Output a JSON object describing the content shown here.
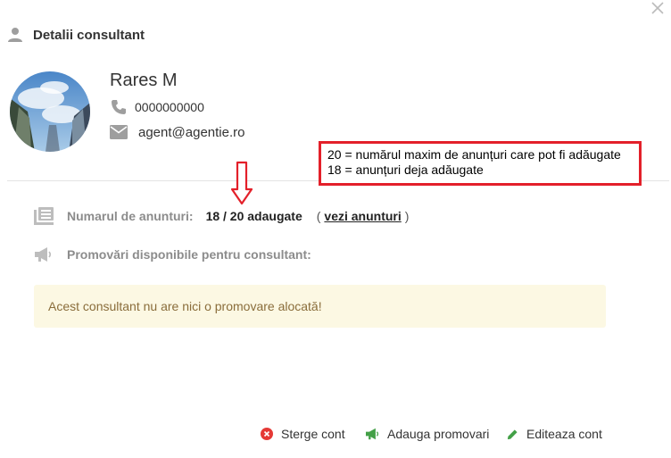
{
  "modal": {
    "title": "Detalii consultant",
    "close_icon": "close-icon"
  },
  "consultant": {
    "name": "Rares M",
    "phone": "0000000000",
    "email": "agent@agentie.ro"
  },
  "annotation": {
    "line1": "20 = numărul maxim de anunțuri care pot fi adăugate",
    "line2": "18 = anunțuri deja adăugate",
    "color": "#e3202a"
  },
  "listings": {
    "label": "Numarul de anunturi:",
    "count": "18 / 20 adaugate",
    "link_open": "(",
    "link_label": "vezi anunturi",
    "link_close": ")"
  },
  "promotions": {
    "label": "Promovări disponibile pentru consultant:",
    "empty_message": "Acest consultant nu are nici o promovare alocată!"
  },
  "footer": {
    "delete_label": "Sterge cont",
    "add_promo_label": "Adauga promovari",
    "edit_label": "Editeaza cont"
  },
  "colors": {
    "delete_icon": "#e53935",
    "promo_icon": "#43a047",
    "edit_icon": "#43a047",
    "alert_bg": "#fcf8e3",
    "alert_text": "#8a6d3b"
  }
}
